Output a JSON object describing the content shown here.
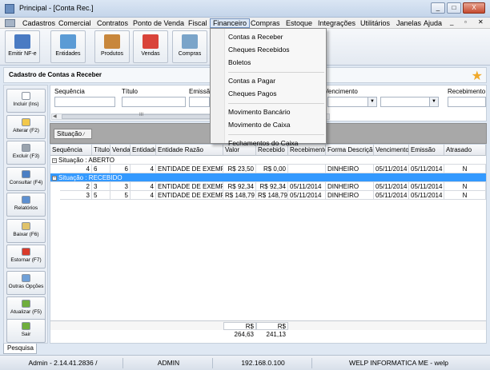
{
  "window": {
    "title": "Principal - [Conta Rec.]",
    "buttons": [
      "_",
      "□",
      "X"
    ]
  },
  "menubar": {
    "items": [
      "Cadastros",
      "Comercial",
      "Contratos",
      "Ponto de Venda",
      "Fiscal",
      "Financeiro",
      "Compras",
      "Estoque",
      "Integrações",
      "Utilitários",
      "Janelas",
      "Ajuda"
    ],
    "active": "Financeiro",
    "mdi_buttons": [
      "_",
      "▫",
      "✕"
    ]
  },
  "toolbar": {
    "buttons": [
      {
        "label": "Emitir NF-e",
        "icon": "invoice-icon",
        "color": "#4a7bc3"
      },
      {
        "label": "Entidades",
        "icon": "contact-card-icon",
        "color": "#5b9bd5"
      },
      {
        "label": "Produtos",
        "icon": "box-icon",
        "color": "#c8873c"
      },
      {
        "label": "Vendas",
        "icon": "gift-icon",
        "color": "#d9443a"
      },
      {
        "label": "Compras",
        "icon": "basket-icon",
        "color": "#7aa4c9"
      }
    ]
  },
  "form": {
    "title": "Cadastro de Contas a Receber",
    "favorite_icon": "star-icon"
  },
  "left_panel": {
    "buttons": [
      {
        "label": "Incluir (Ins)",
        "icon": "new-document-icon",
        "color": "#ffffff"
      },
      {
        "label": "Alterar (F2)",
        "icon": "edit-icon",
        "color": "#f2c84b"
      },
      {
        "label": "Excluir (F3)",
        "icon": "trash-icon",
        "color": "#9aa3ad"
      },
      {
        "label": "Consultar (F4)",
        "icon": "search-icon",
        "color": "#4b7fc4"
      },
      {
        "label": "Relatórios",
        "icon": "report-icon",
        "color": "#5c8fd1"
      },
      {
        "label": "Baixar (F6)",
        "icon": "download-icon",
        "color": "#e0c36a"
      },
      {
        "label": "Estornar (F7)",
        "icon": "cancel-icon",
        "color": "#d93a2a"
      },
      {
        "label": "Outras Opções",
        "icon": "options-icon",
        "color": "#6fa0d8"
      },
      {
        "label": "Atualizar (F5)",
        "icon": "refresh-icon",
        "color": "#6fae3d"
      }
    ],
    "exit_button": {
      "label": "Sair",
      "icon": "exit-icon",
      "color": "#6fae3d"
    }
  },
  "filters": {
    "labels": [
      "Sequência",
      "Título",
      "Emissão",
      "Vencimento",
      "Recebimento"
    ],
    "scroll_label": "III"
  },
  "group_by": {
    "chip": "Situação"
  },
  "grid": {
    "columns": [
      "Sequência",
      "Título",
      "Venda",
      "Entidade",
      "Entidade Razão",
      "Valor",
      "Recebido",
      "Recebimento",
      "Forma Descrição",
      "Vencimento",
      "Emissão",
      "Atrasado"
    ],
    "groups": [
      {
        "label": "Situação : ABERTO",
        "expander": "−",
        "selected": false,
        "rows": [
          [
            "4",
            "6",
            "6",
            "4",
            "ENTIDADE DE EXEMPLO",
            "R$ 23,50",
            "R$ 0,00",
            "",
            "DINHEIRO",
            "05/11/2014",
            "05/11/2014",
            "N"
          ]
        ]
      },
      {
        "label": "Situação : RECEBIDO",
        "expander": "−",
        "selected": true,
        "rows": [
          [
            "2",
            "3",
            "3",
            "4",
            "ENTIDADE DE EXEMPLO",
            "R$ 92,34",
            "R$ 92,34",
            "05/11/2014",
            "DINHEIRO",
            "05/11/2014",
            "05/11/2014",
            "N"
          ],
          [
            "3",
            "5",
            "5",
            "4",
            "ENTIDADE DE EXEMPLO",
            "R$ 148,79",
            "R$ 148,79",
            "05/11/2014",
            "DINHEIRO",
            "05/11/2014",
            "05/11/2014",
            "N"
          ]
        ]
      }
    ],
    "totals": {
      "valor": "R$ 264,63",
      "recebido": "R$ 241,13"
    }
  },
  "tabs": {
    "active": "Pesquisa"
  },
  "statusbar": [
    "Admin - 2.14.41.2836 /",
    "ADMIN",
    "192.168.0.100",
    "WELP INFORMATICA ME - welp"
  ],
  "dropdown": {
    "items": [
      {
        "label": "Contas a Receber"
      },
      {
        "label": "Cheques Recebidos"
      },
      {
        "label": "Boletos"
      },
      {
        "sep": true
      },
      {
        "label": "Contas a Pagar"
      },
      {
        "label": "Cheques Pagos"
      },
      {
        "sep": true
      },
      {
        "label": "Movimento Bancário"
      },
      {
        "label": "Movimento de Caixa"
      },
      {
        "sep": true
      },
      {
        "label": "Fechamentos do Caixa"
      }
    ]
  }
}
